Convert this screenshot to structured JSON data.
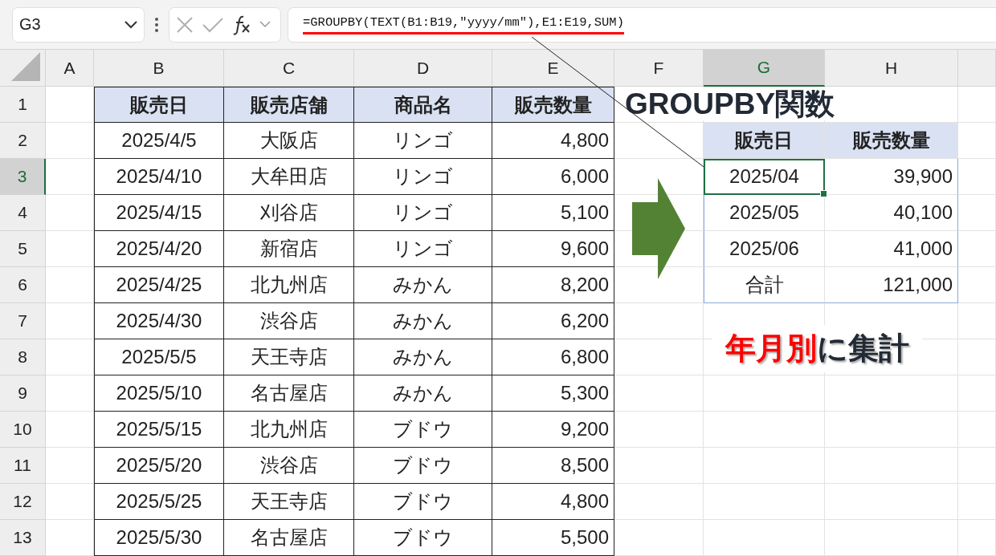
{
  "name_box": {
    "value": "G3"
  },
  "formula_bar": {
    "formula": "=GROUPBY(TEXT(B1:B19,\"yyyy/mm\"),E1:E19,SUM)",
    "underlined": true
  },
  "columns": [
    {
      "label": "A",
      "selected": false
    },
    {
      "label": "B",
      "selected": false
    },
    {
      "label": "C",
      "selected": false
    },
    {
      "label": "D",
      "selected": false
    },
    {
      "label": "E",
      "selected": false
    },
    {
      "label": "F",
      "selected": false
    },
    {
      "label": "G",
      "selected": true
    },
    {
      "label": "H",
      "selected": false
    }
  ],
  "row_headers": [
    {
      "label": "1",
      "selected": false
    },
    {
      "label": "2",
      "selected": false
    },
    {
      "label": "3",
      "selected": true
    },
    {
      "label": "4",
      "selected": false
    },
    {
      "label": "5",
      "selected": false
    },
    {
      "label": "6",
      "selected": false
    },
    {
      "label": "7",
      "selected": false
    },
    {
      "label": "8",
      "selected": false
    },
    {
      "label": "9",
      "selected": false
    },
    {
      "label": "10",
      "selected": false
    },
    {
      "label": "11",
      "selected": false
    },
    {
      "label": "12",
      "selected": false
    },
    {
      "label": "13",
      "selected": false
    }
  ],
  "sales_table": {
    "columns": [
      "販売日",
      "販売店舗",
      "商品名",
      "販売数量"
    ],
    "rows": [
      [
        "2025/4/5",
        "大阪店",
        "リンゴ",
        "4,800"
      ],
      [
        "2025/4/10",
        "大牟田店",
        "リンゴ",
        "6,000"
      ],
      [
        "2025/4/15",
        "刈谷店",
        "リンゴ",
        "5,100"
      ],
      [
        "2025/4/20",
        "新宿店",
        "リンゴ",
        "9,600"
      ],
      [
        "2025/4/25",
        "北九州店",
        "みかん",
        "8,200"
      ],
      [
        "2025/4/30",
        "渋谷店",
        "みかん",
        "6,200"
      ],
      [
        "2025/5/5",
        "天王寺店",
        "みかん",
        "6,800"
      ],
      [
        "2025/5/10",
        "名古屋店",
        "みかん",
        "5,300"
      ],
      [
        "2025/5/15",
        "北九州店",
        "ブドウ",
        "9,200"
      ],
      [
        "2025/5/20",
        "渋谷店",
        "ブドウ",
        "8,500"
      ],
      [
        "2025/5/25",
        "天王寺店",
        "ブドウ",
        "4,800"
      ],
      [
        "2025/5/30",
        "名古屋店",
        "ブドウ",
        "5,500"
      ]
    ]
  },
  "result_table": {
    "columns": [
      "販売日",
      "販売数量"
    ],
    "rows": [
      [
        {
          "text": "2025/04",
          "selected": true
        },
        {
          "text": "39,900",
          "selected": false
        }
      ],
      [
        {
          "text": "2025/05",
          "selected": false
        },
        {
          "text": "40,100",
          "selected": false
        }
      ],
      [
        {
          "text": "2025/06",
          "selected": false
        },
        {
          "text": "41,000",
          "selected": false
        }
      ],
      [
        {
          "text": "合計",
          "selected": false
        },
        {
          "text": "121,000",
          "selected": false
        }
      ]
    ]
  },
  "title_label": {
    "text": "GROUPBY関数"
  },
  "caption": {
    "parts": [
      {
        "text": "年月別",
        "emphasis": true
      },
      {
        "text": "に集計",
        "emphasis": false
      }
    ]
  }
}
